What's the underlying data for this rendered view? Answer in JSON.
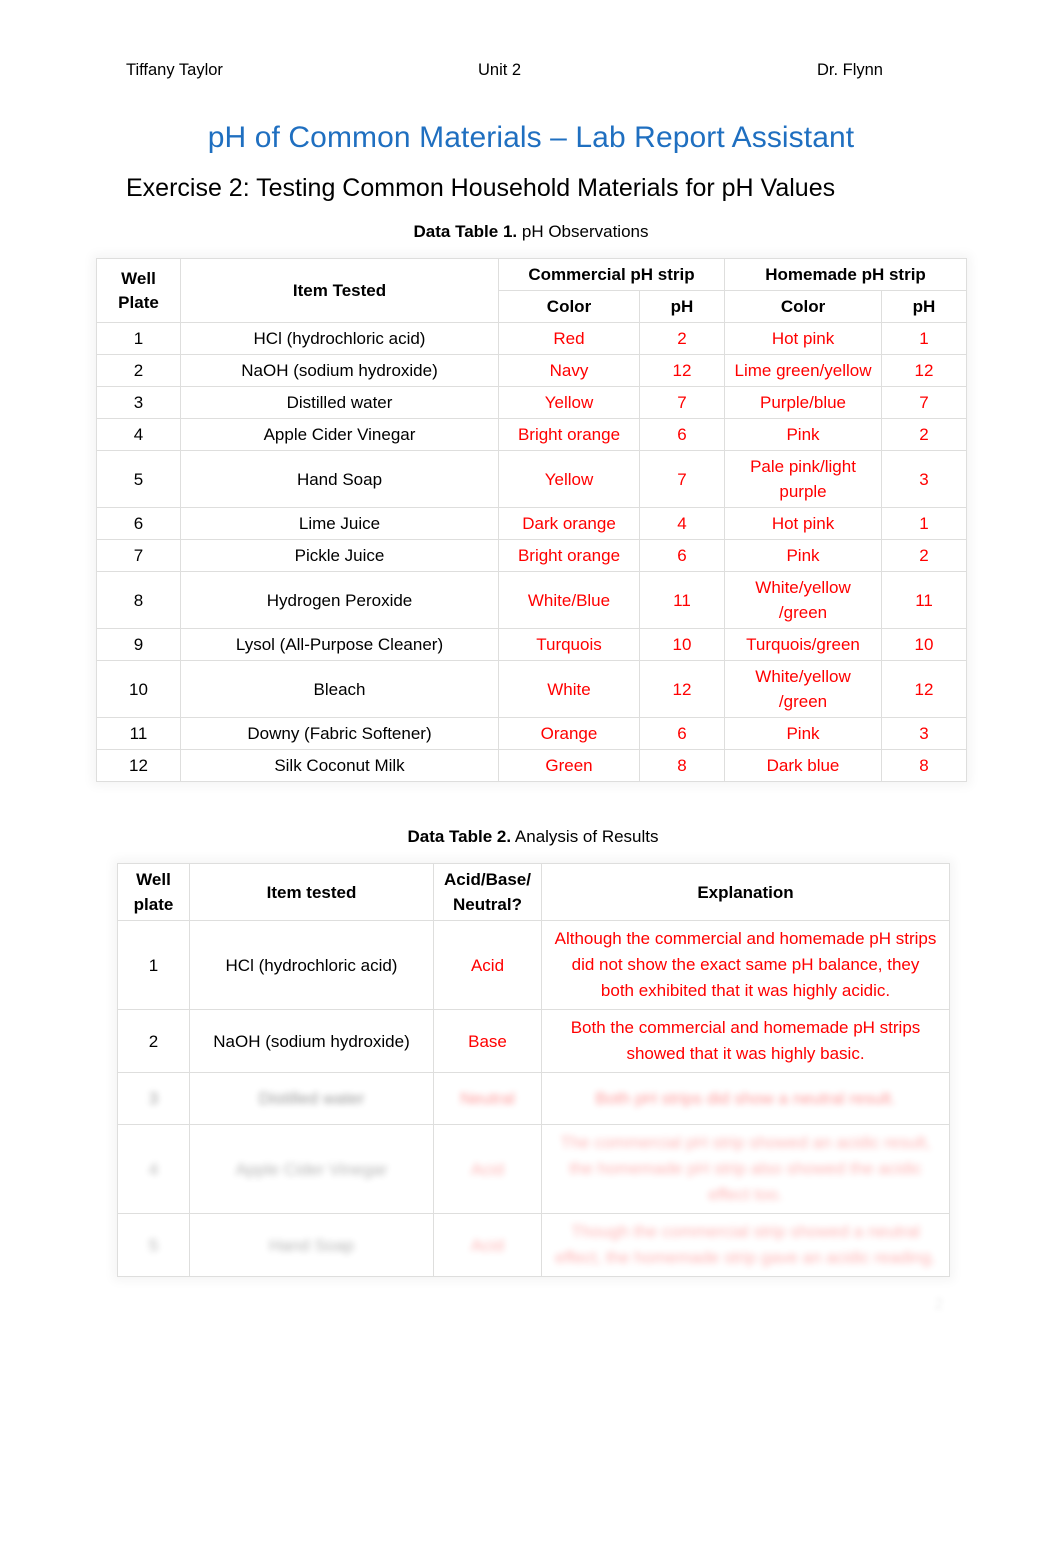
{
  "header": {
    "left": "Tiffany Taylor",
    "center": "Unit 2",
    "right": "Dr. Flynn"
  },
  "title": "pH of Common Materials – Lab Report Assistant",
  "subtitle": "Exercise 2: Testing Common Household Materials for pH Values",
  "colors": {
    "title_blue": "#1F6FC0",
    "data_red": "#FF0000",
    "table_border": "#DEDEDD",
    "text_black": "#000000"
  },
  "table1": {
    "caption_bold": "Data Table 1.",
    "caption_rest": " pH Observations",
    "headers": {
      "well_plate": "Well Plate",
      "item_tested": "Item Tested",
      "commercial_group": "Commercial pH strip",
      "homemade_group": "Homemade pH strip",
      "color": "Color",
      "ph": "pH",
      "color2": "Color",
      "ph2": "pH"
    },
    "rows": [
      {
        "well": "1",
        "item": "HCl (hydrochloric acid)",
        "c_color": "Red",
        "c_ph": "2",
        "h_color": "Hot pink",
        "h_ph": "1"
      },
      {
        "well": "2",
        "item": "NaOH (sodium hydroxide)",
        "c_color": "Navy",
        "c_ph": "12",
        "h_color": "Lime green/yellow",
        "h_ph": "12"
      },
      {
        "well": "3",
        "item": "Distilled water",
        "c_color": "Yellow",
        "c_ph": "7",
        "h_color": "Purple/blue",
        "h_ph": "7"
      },
      {
        "well": "4",
        "item": "Apple Cider Vinegar",
        "c_color": "Bright orange",
        "c_ph": "6",
        "h_color": "Pink",
        "h_ph": "2"
      },
      {
        "well": "5",
        "item": "Hand Soap",
        "c_color": "Yellow",
        "c_ph": "7",
        "h_color": "Pale pink/light purple",
        "h_ph": "3"
      },
      {
        "well": "6",
        "item": "Lime Juice",
        "c_color": "Dark orange",
        "c_ph": "4",
        "h_color": "Hot pink",
        "h_ph": "1"
      },
      {
        "well": "7",
        "item": "Pickle Juice",
        "c_color": "Bright orange",
        "c_ph": "6",
        "h_color": "Pink",
        "h_ph": "2"
      },
      {
        "well": "8",
        "item": "Hydrogen Peroxide",
        "c_color": "White/Blue",
        "c_ph": "11",
        "h_color": "White/yellow /green",
        "h_ph": "11"
      },
      {
        "well": "9",
        "item": "Lysol (All-Purpose Cleaner)",
        "c_color": "Turquois",
        "c_ph": "10",
        "h_color": "Turquois/green",
        "h_ph": "10"
      },
      {
        "well": "10",
        "item": "Bleach",
        "c_color": "White",
        "c_ph": "12",
        "h_color": "White/yellow /green",
        "h_ph": "12"
      },
      {
        "well": "11",
        "item": "Downy (Fabric Softener)",
        "c_color": "Orange",
        "c_ph": "6",
        "h_color": "Pink",
        "h_ph": "3"
      },
      {
        "well": "12",
        "item": "Silk Coconut Milk",
        "c_color": "Green",
        "c_ph": "8",
        "h_color": "Dark blue",
        "h_ph": "8"
      }
    ]
  },
  "table2": {
    "caption_bold": "Data Table 2.",
    "caption_rest": " Analysis of Results",
    "headers": {
      "well_plate": "Well plate",
      "item_tested": "Item tested",
      "acid_base_neutral": "Acid/Base/ Neutral?",
      "explanation": "Explanation"
    },
    "rows": [
      {
        "well": "1",
        "item": "HCl (hydrochloric acid)",
        "abn": "Acid",
        "explanation": "Although the commercial and homemade pH strips did not show the exact same pH balance, they both exhibited that it was highly acidic.",
        "faded": false
      },
      {
        "well": "2",
        "item": "NaOH (sodium hydroxide)",
        "abn": "Base",
        "explanation": "Both the commercial and homemade pH strips showed that it was highly basic.",
        "faded": false
      },
      {
        "well": "3",
        "item": "Distilled water",
        "abn": "Neutral",
        "explanation": "Both pH strips did show a neutral result.",
        "faded": true
      },
      {
        "well": "4",
        "item": "Apple Cider Vinegar",
        "abn": "Acid",
        "explanation": "The commercial pH strip showed an acidic result, the homemade pH strip also showed the acidic effect too.",
        "faded": true
      },
      {
        "well": "5",
        "item": "Hand Soap",
        "abn": "Acid",
        "explanation": "Though the commercial strip showed a neutral effect, the homemade strip gave an acidic reading.",
        "faded": true
      }
    ]
  },
  "page_mark": "2"
}
